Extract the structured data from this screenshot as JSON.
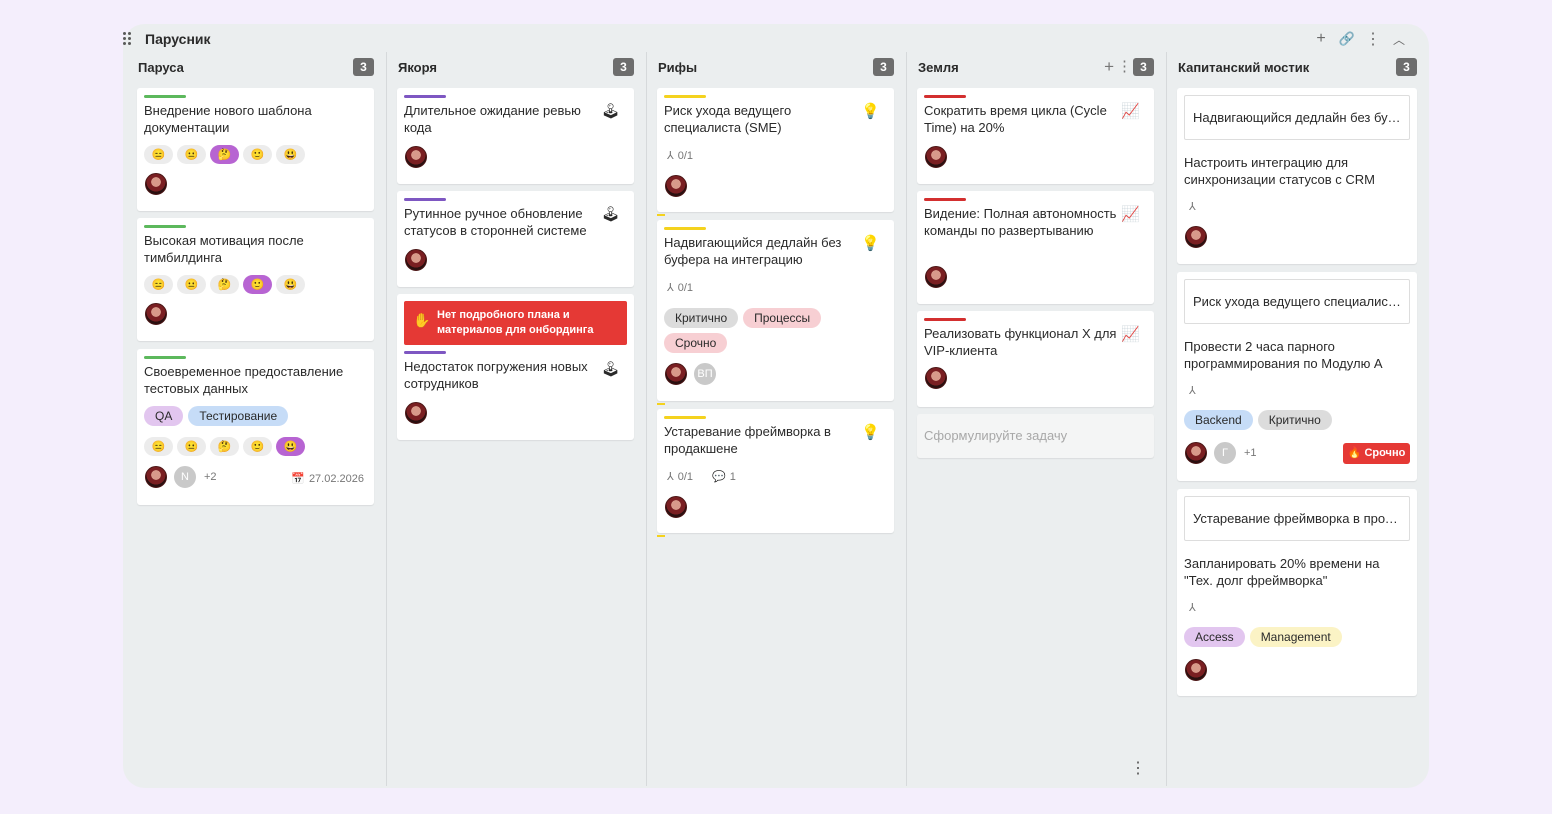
{
  "board": {
    "title": "Парусник",
    "actions": [
      "plus-icon",
      "link-icon",
      "more-vertical-icon",
      "chevron-up-icon"
    ]
  },
  "columns": [
    {
      "title": "Паруса",
      "count": "3",
      "cards": [
        {
          "title": "Внедрение нового шаблона документации",
          "strip": "#5cb85c"
        },
        {
          "title": "Высокая мотивация после тимбилдинга",
          "strip": "#5cb85c"
        },
        {
          "title": "Своевременное предоставление тестовых данных",
          "strip": "#5cb85c",
          "tags": [
            "QA",
            "Тестирование"
          ],
          "extra_count": "+2",
          "avatar_letter": "N",
          "date": "27.02.2026"
        }
      ]
    },
    {
      "title": "Якоря",
      "count": "3",
      "cards": [
        {
          "title": "Длительное ожидание ревью кода",
          "strip": "#7e57c2"
        },
        {
          "title": "Рутинное ручное обновление статусов в сторонней системе",
          "strip": "#7e57c2"
        },
        {
          "title": "Недостаток погружения новых сотрудников",
          "strip": "#7e57c2",
          "alert": "Нет подробного плана и материалов для онбординга"
        }
      ]
    },
    {
      "title": "Рифы",
      "count": "3",
      "cards": [
        {
          "title": "Риск ухода ведущего специалиста (SME)",
          "strip": "#f4d21e",
          "subtasks": "0/1"
        },
        {
          "title": "Надвигающийся дедлайн без буфера на интеграцию",
          "strip": "#f4d21e",
          "subtasks": "0/1",
          "tags": [
            "Критично",
            "Процессы",
            "Срочно"
          ],
          "avatar_letters": "ВП"
        },
        {
          "title": "Устаревание фреймворка в продакшене",
          "strip": "#f4d21e",
          "subtasks": "0/1",
          "comments": "1"
        }
      ]
    },
    {
      "title": "Земля",
      "count": "3",
      "cards": [
        {
          "title": "Сократить время цикла (Cycle Time) на 20%",
          "strip": "#d32f2f"
        },
        {
          "title": "Видение: Полная автономность команды по развертыванию",
          "strip": "#d32f2f"
        },
        {
          "title": "Реализовать функционал X для VIP-клиента",
          "strip": "#d32f2f"
        }
      ],
      "new_task_placeholder": "Сформулируйте задачу"
    },
    {
      "title": "Капитанский мостик",
      "count": "3",
      "cards": [
        {
          "box": "Надвигающийся дедлайн без буфера на интеграцию",
          "title": "Настроить интеграцию для синхронизации статусов с CRM"
        },
        {
          "box": "Риск ухода ведущего специалиста (SME)",
          "title": "Провести 2 часа парного программирования по Модулю А",
          "tags": [
            "Backend",
            "Критично"
          ],
          "avatar_letter": "Г",
          "extra_count": "+1",
          "urgent": "Срочно"
        },
        {
          "box": "Устаревание фреймворка в продакшене",
          "title": "Запланировать 20% времени на \"Тех. долг фреймворка\"",
          "tags": [
            "Access",
            "Management"
          ]
        }
      ]
    }
  ],
  "emojis": [
    "😑",
    "😐",
    "🤔",
    "🙂",
    "😃"
  ],
  "colors": {
    "page_bg": "#f4eefc",
    "board_bg": "#ebeeef",
    "emoji_active": "#b764d2",
    "tag_purple": "#e2c6ef",
    "tag_blue": "#c6dcf7",
    "tag_gray": "#dcdcdc",
    "tag_pink": "#f7cfd3",
    "tag_yellow": "#fbf3c5",
    "alert_red": "#e53935"
  }
}
